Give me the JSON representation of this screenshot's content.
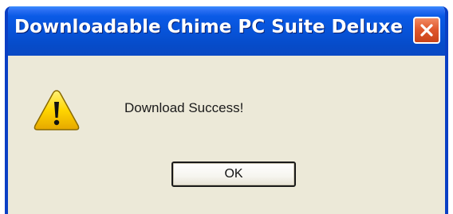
{
  "window": {
    "title": "Downloadable Chime PC Suite Deluxe",
    "close_icon": "close-icon",
    "titlebar_color": "#0752d6",
    "client_color": "#ece9d8"
  },
  "dialog": {
    "icon": "warning-icon",
    "message": "Download Success!",
    "ok_label": "OK"
  }
}
